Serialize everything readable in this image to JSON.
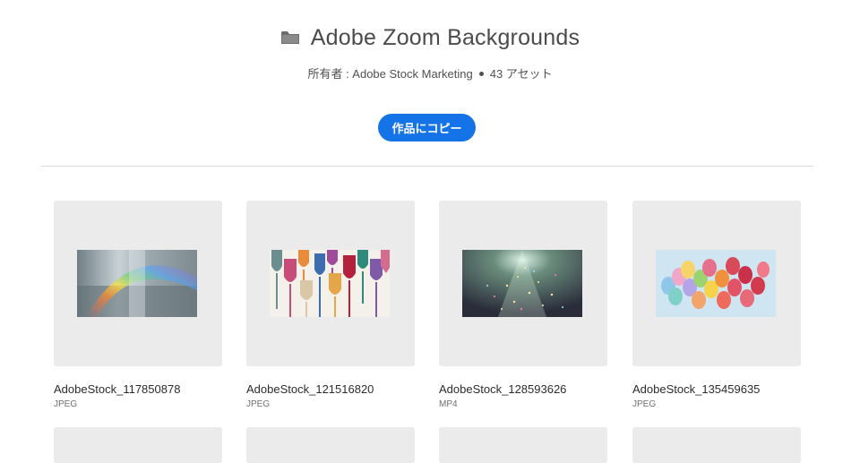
{
  "header": {
    "title": "Adobe Zoom Backgrounds",
    "owner": "所有者 : Adobe Stock Marketing",
    "asset_count": "43 アセット",
    "copy_button_label": "作品にコピー",
    "folder_icon": "folder-icon"
  },
  "colors": {
    "accent": "#1473e6",
    "thumb_bg": "#ebebeb",
    "divider": "#d8d8d8"
  },
  "assets": [
    {
      "name": "AdobeStock_117850878",
      "type": "JPEG"
    },
    {
      "name": "AdobeStock_121516820",
      "type": "JPEG"
    },
    {
      "name": "AdobeStock_128593626",
      "type": "MP4"
    },
    {
      "name": "AdobeStock_135459635",
      "type": "JPEG"
    }
  ]
}
